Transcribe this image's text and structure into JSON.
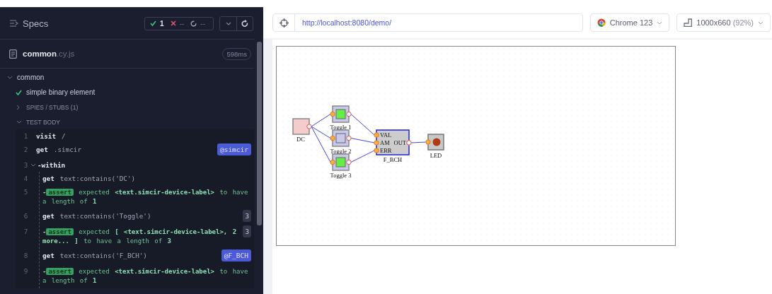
{
  "specs_panel": {
    "title": "Specs",
    "stats": {
      "passed": "1",
      "failed": "--",
      "pending": "--"
    },
    "file": {
      "name": "common",
      "ext": ".cy.js",
      "duration": "598ms"
    },
    "suite": {
      "title": "common",
      "expanded": true
    },
    "test": {
      "title": "simple binary element",
      "passed": true
    },
    "sections": [
      {
        "title": "SPIES / STUBS (1)",
        "expanded": false
      },
      {
        "title": "TEST BODY",
        "expanded": true
      }
    ],
    "commands": [
      {
        "number": "1",
        "kind": "command",
        "name": "visit",
        "message": "/"
      },
      {
        "number": "2",
        "kind": "command",
        "name": "get",
        "message": ".simcir",
        "alias": "@simcir"
      },
      {
        "number": "3",
        "kind": "group",
        "name": "-within",
        "expanded": true,
        "children": [
          {
            "number": "4",
            "kind": "command",
            "name": "get",
            "message": "text:contains('DC')"
          },
          {
            "number": "5",
            "kind": "assert",
            "prefix": "-",
            "name": "assert",
            "message": "expected **<text.simcir-device-label>** to have a length of **1**"
          },
          {
            "number": "6",
            "kind": "command",
            "name": "get",
            "message": "text:contains('Toggle')",
            "count": "3"
          },
          {
            "number": "7",
            "kind": "assert",
            "prefix": "-",
            "name": "assert",
            "message": "expected **[ <text.simcir-device-label>, 2 more... ]** to have a length of **3**",
            "count": "3"
          },
          {
            "number": "8",
            "kind": "command",
            "name": "get",
            "message": "text:contains('F_BCH')",
            "alias": "@F_BCH"
          },
          {
            "number": "9",
            "kind": "assert",
            "prefix": "-",
            "name": "assert",
            "message": "expected **<text.simcir-device-label>** to have a length of **1**"
          }
        ]
      }
    ]
  },
  "browser_bar": {
    "url": "http://localhost:8080/demo/",
    "browser": "Chrome 123",
    "viewport": "1000x660",
    "zoom": "(92%)"
  },
  "circuit": {
    "devices": [
      {
        "kind": "dc",
        "label": "DC"
      },
      {
        "kind": "toggle",
        "label": "Toggle 1",
        "on": true
      },
      {
        "kind": "toggle",
        "label": "Toggle 2",
        "on": false
      },
      {
        "kind": "toggle",
        "label": "Toggle 3",
        "on": true
      },
      {
        "kind": "block",
        "label": "F_BCH",
        "inputs": [
          "VAL",
          "AM",
          "ERR"
        ],
        "outputs": [
          "OUT"
        ]
      },
      {
        "kind": "led",
        "label": "LED",
        "on": true
      }
    ]
  }
}
